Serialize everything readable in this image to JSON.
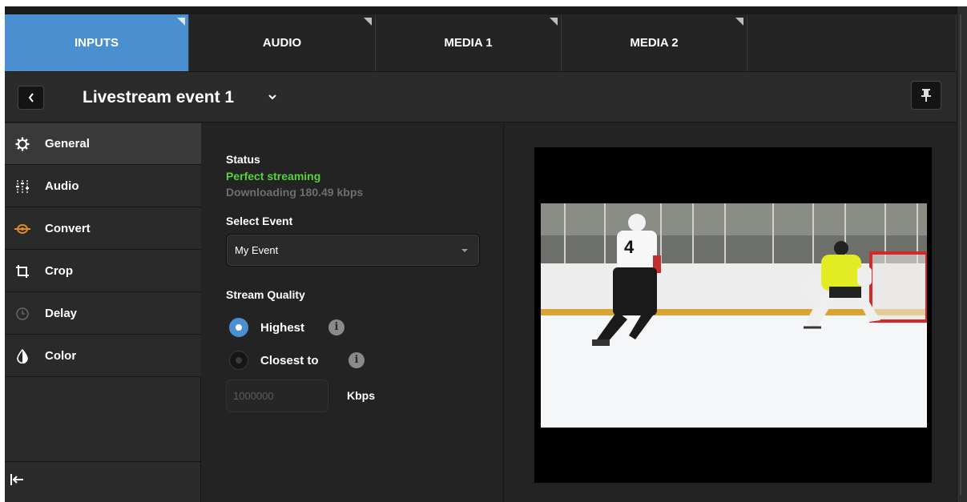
{
  "tabs": [
    {
      "label": "INPUTS",
      "active": true
    },
    {
      "label": "AUDIO",
      "active": false
    },
    {
      "label": "MEDIA 1",
      "active": false
    },
    {
      "label": "MEDIA 2",
      "active": false
    }
  ],
  "header": {
    "title": "Livestream event 1",
    "back_icon": "chevron-left-icon",
    "dropdown_icon": "chevron-down-icon",
    "pin_icon": "pin-icon"
  },
  "sidebar": {
    "items": [
      {
        "label": "General",
        "icon": "gear-icon",
        "active": true
      },
      {
        "label": "Audio",
        "icon": "sliders-icon",
        "active": false
      },
      {
        "label": "Convert",
        "icon": "convert-icon",
        "active": false
      },
      {
        "label": "Crop",
        "icon": "crop-icon",
        "active": false
      },
      {
        "label": "Delay",
        "icon": "clock-icon",
        "active": false
      },
      {
        "label": "Color",
        "icon": "droplet-icon",
        "active": false
      }
    ],
    "collapse_icon": "collapse-left-icon"
  },
  "panel": {
    "status_label": "Status",
    "status_value": "Perfect streaming",
    "status_detail": "Downloading 180.49 kbps",
    "select_event_label": "Select Event",
    "select_event_value": "My Event",
    "stream_quality_label": "Stream Quality",
    "option_highest": "Highest",
    "option_closest": "Closest to",
    "info_glyph": "i",
    "kbps_placeholder": "1000000",
    "kbps_unit": "Kbps"
  },
  "colors": {
    "accent": "#4a8fd0",
    "status_ok": "#56d33b",
    "background": "#232323"
  }
}
